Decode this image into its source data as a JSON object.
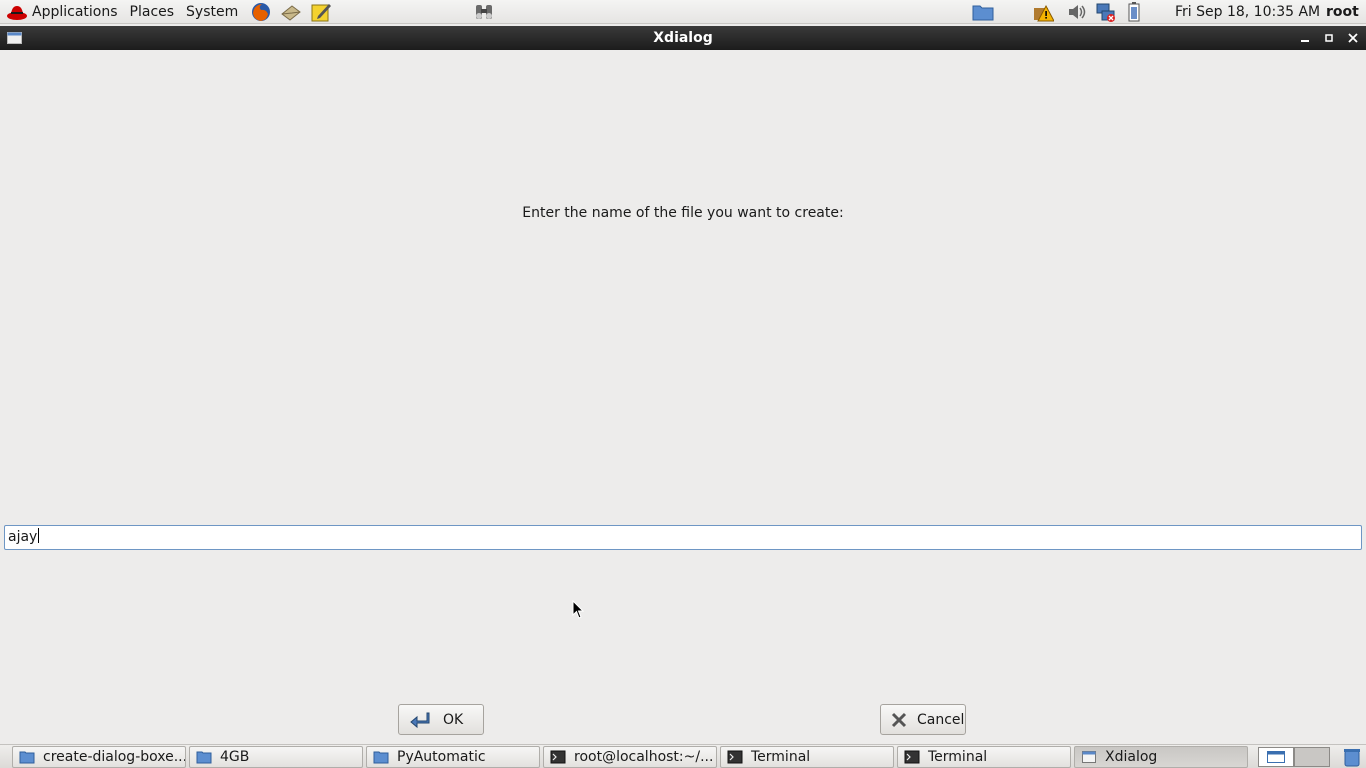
{
  "top_panel": {
    "menus": [
      "Applications",
      "Places",
      "System"
    ],
    "clock": "Fri Sep 18, 10:35 AM",
    "user": "root"
  },
  "window": {
    "title": "Xdialog"
  },
  "dialog": {
    "prompt": "Enter the name of the file you want to create:",
    "input_value": "ajay",
    "ok_label": "OK",
    "cancel_label": "Cancel"
  },
  "taskbar": {
    "items": [
      {
        "label": "create-dialog-boxe...",
        "icon": "folder-icon"
      },
      {
        "label": "4GB",
        "icon": "folder-icon"
      },
      {
        "label": "PyAutomatic",
        "icon": "folder-icon"
      },
      {
        "label": "root@localhost:~/...",
        "icon": "terminal-icon"
      },
      {
        "label": "Terminal",
        "icon": "terminal-icon"
      },
      {
        "label": "Terminal",
        "icon": "terminal-icon"
      },
      {
        "label": "Xdialog",
        "icon": "window-icon"
      }
    ]
  },
  "colors": {
    "background": "#edeceb",
    "titlebar": "#1c1c1c",
    "entry_border": "#6e96c4"
  }
}
